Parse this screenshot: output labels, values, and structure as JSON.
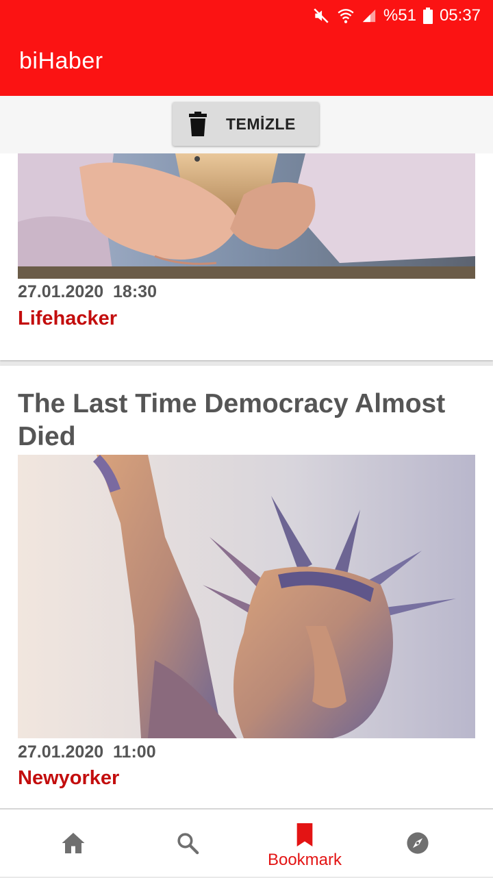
{
  "status_bar": {
    "battery": "%51",
    "time": "05:37",
    "icons": [
      "mute-icon",
      "wifi-icon",
      "signal-icon",
      "battery-icon"
    ]
  },
  "app": {
    "title": "biHaber",
    "accent": "#fb1313"
  },
  "toolbar": {
    "clear_label": "TEMİZLE",
    "clear_icon": "trash-icon"
  },
  "articles": [
    {
      "date": "27.01.2020",
      "time": "18:30",
      "source": "Lifehacker",
      "image": "hands-holding-phone-photo"
    },
    {
      "title": "The Last Time Democracy Almost Died",
      "date": "27.01.2020",
      "time": "11:00",
      "source": "Newyorker",
      "image": "statue-of-liberty-illustration"
    }
  ],
  "bottom_nav": {
    "items": [
      {
        "icon": "home-icon"
      },
      {
        "icon": "search-icon"
      },
      {
        "icon": "bookmark-icon",
        "label": "Bookmark",
        "active": true
      },
      {
        "icon": "compass-icon"
      }
    ],
    "active_color": "#e31414"
  },
  "colors": {
    "source": "#c30d0d",
    "meta": "#555555"
  }
}
